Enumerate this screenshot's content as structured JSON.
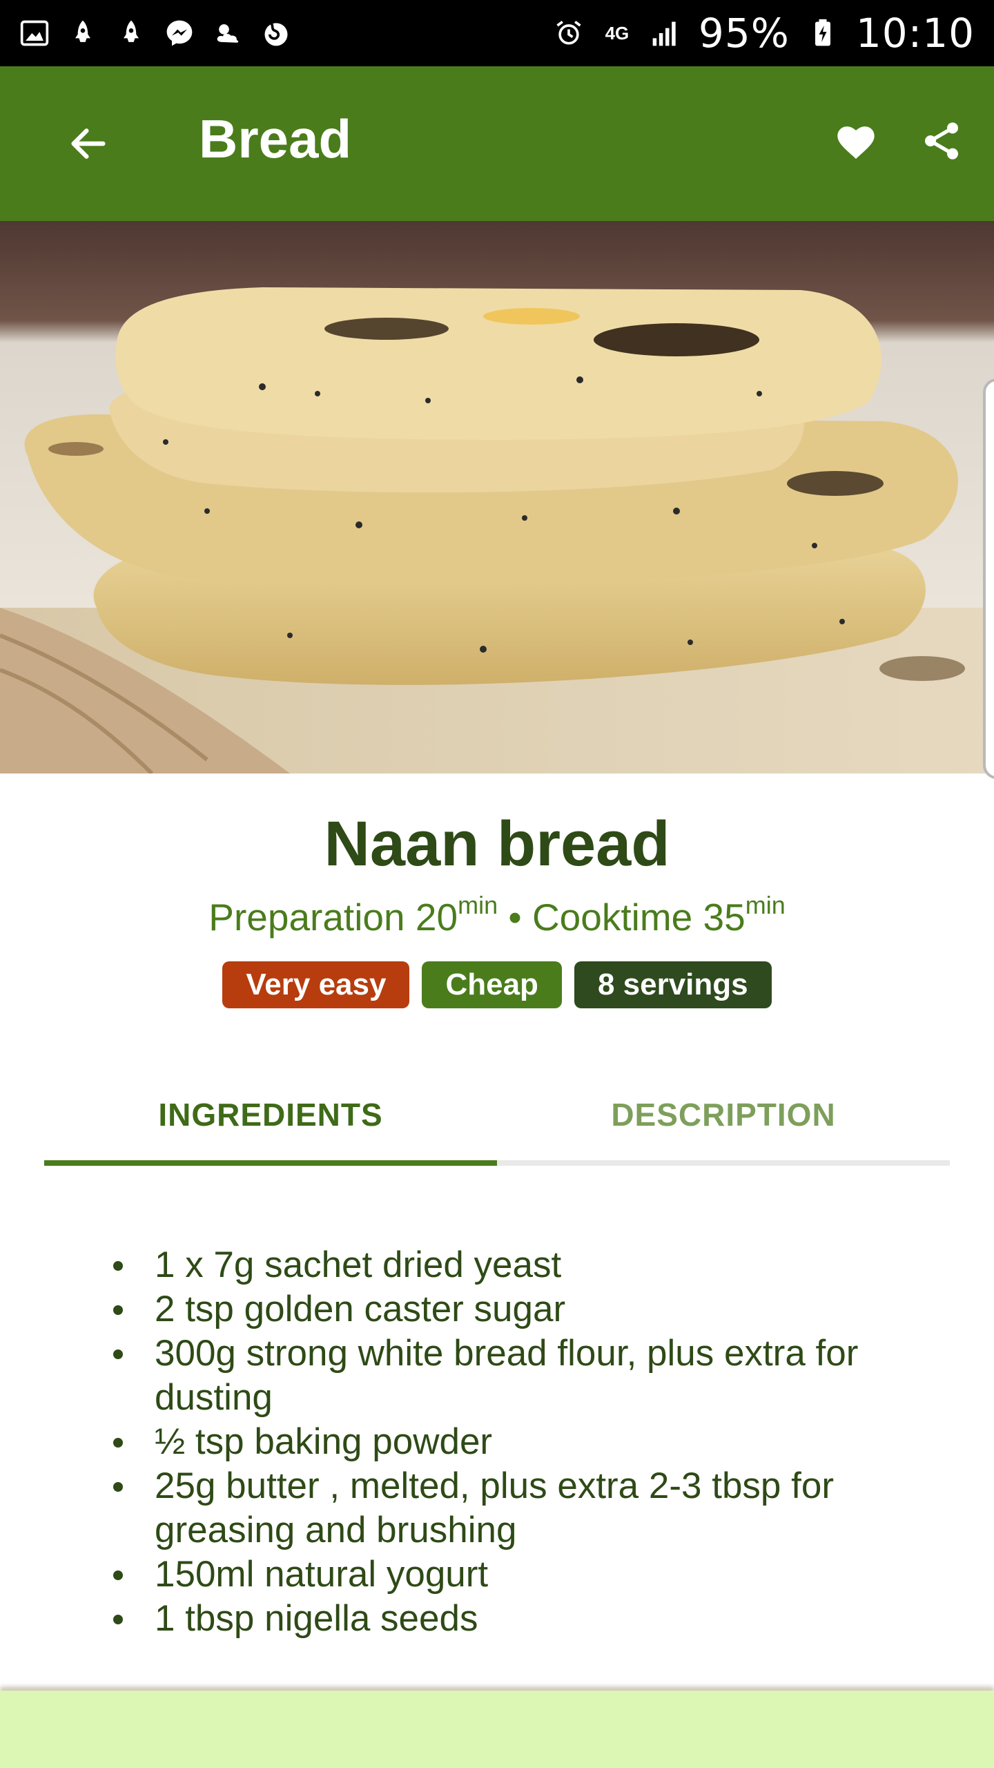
{
  "status_bar": {
    "battery": "95%",
    "time": "10:10",
    "network": "4G",
    "icons": [
      "gallery-icon",
      "rocket-icon",
      "rocket-icon",
      "messenger-icon",
      "weather-icon",
      "firefox-icon",
      "alarm-icon",
      "network-4g-icon",
      "signal-icon",
      "battery-charging-icon"
    ]
  },
  "app_bar": {
    "title": "Bread",
    "background": "#4a7c1c"
  },
  "recipe": {
    "title": "Naan bread",
    "prep_label": "Preparation",
    "prep_value": "20",
    "prep_unit": "min",
    "separator": "•",
    "cook_label": "Cooktime",
    "cook_value": "35",
    "cook_unit": "min",
    "badges": {
      "difficulty": "Very easy",
      "cost": "Cheap",
      "servings": "8 servings"
    }
  },
  "tabs": [
    {
      "label": "INGREDIENTS",
      "active": true
    },
    {
      "label": "DESCRIPTION",
      "active": false
    }
  ],
  "ingredients": [
    "1 x 7g sachet dried yeast",
    "2 tsp golden caster sugar",
    "300g strong white bread flour, plus extra for dusting",
    "½ tsp baking powder",
    "25g butter , melted, plus extra 2-3 tbsp for greasing and brushing",
    "150ml natural yogurt",
    "1 tbsp nigella seeds"
  ],
  "colors": {
    "primary": "#4a7c1c",
    "dark_green": "#2e4a16",
    "difficulty_badge": "#b73d0e",
    "bottom_panel": "#dcf7b4"
  }
}
